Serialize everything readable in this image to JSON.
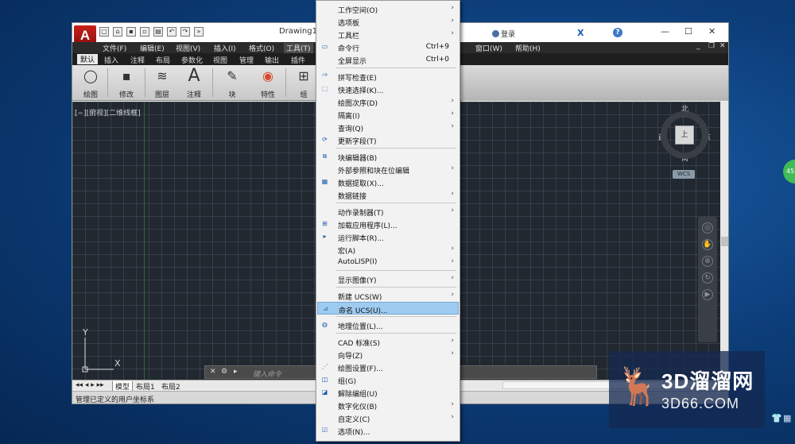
{
  "app": {
    "logo_glyph": "A",
    "document_title": "Drawing1.d",
    "login_label": "登录",
    "help_glyph": "?",
    "x_glyph": "X"
  },
  "menu_bar": {
    "items": [
      "文件(F)",
      "编辑(E)",
      "视图(V)",
      "插入(I)",
      "格式(O)",
      "工具(T)",
      "窗口(W)",
      "帮助(H)"
    ],
    "active": "工具(T)"
  },
  "ribbon_tabs": [
    "默认",
    "插入",
    "注释",
    "布局",
    "参数化",
    "视图",
    "管理",
    "输出",
    "插件"
  ],
  "ribbon_panels": [
    "绘图",
    "修改",
    "图层",
    "注释",
    "块",
    "特性",
    "组"
  ],
  "viewport": {
    "label": "[−][俯视][二维线框]",
    "compass": {
      "north": "北",
      "south": "南",
      "east": "东",
      "west": "西",
      "center": "上"
    },
    "wcs": "WCS",
    "ucs_x": "X",
    "ucs_y": "Y"
  },
  "command_line": {
    "placeholder": "键入命令"
  },
  "layout_tabs": [
    "模型",
    "布局1",
    "布局2"
  ],
  "status_bar": {
    "text": "管理已定义的用户坐标系"
  },
  "tools_menu": {
    "items": [
      {
        "label": "工作空间(O)",
        "submenu": true
      },
      {
        "label": "选项板",
        "submenu": true
      },
      {
        "label": "工具栏",
        "submenu": true
      },
      {
        "label": "命令行",
        "shortcut": "Ctrl+9",
        "icon": "command-line-icon"
      },
      {
        "label": "全屏显示",
        "shortcut": "Ctrl+0"
      },
      {
        "label": "拼写检查(E)",
        "icon": "spellcheck-icon"
      },
      {
        "label": "快速选择(K)...",
        "icon": "quick-select-icon"
      },
      {
        "label": "绘图次序(D)",
        "submenu": true
      },
      {
        "label": "隔离(I)",
        "submenu": true
      },
      {
        "label": "查询(Q)",
        "submenu": true
      },
      {
        "label": "更新字段(T)",
        "icon": "update-field-icon"
      },
      {
        "label": "块编辑器(B)",
        "icon": "block-editor-icon"
      },
      {
        "label": "外部参照和块在位编辑",
        "submenu": true
      },
      {
        "label": "数据提取(X)...",
        "icon": "data-extract-icon"
      },
      {
        "label": "数据链接",
        "submenu": true
      },
      {
        "label": "动作录制器(T)",
        "submenu": true
      },
      {
        "label": "加载应用程序(L)...",
        "icon": "load-app-icon"
      },
      {
        "label": "运行脚本(R)...",
        "icon": "run-script-icon"
      },
      {
        "label": "宏(A)",
        "submenu": true
      },
      {
        "label": "AutoLISP(I)",
        "submenu": true
      },
      {
        "label": "显示图像(Y)",
        "submenu": true
      },
      {
        "label": "新建 UCS(W)",
        "submenu": true
      },
      {
        "label": "命名 UCS(U)...",
        "icon": "named-ucs-icon",
        "highlight": true
      },
      {
        "label": "地理位置(L)...",
        "icon": "geo-location-icon"
      },
      {
        "label": "CAD 标准(S)",
        "submenu": true
      },
      {
        "label": "向导(Z)",
        "submenu": true
      },
      {
        "label": "绘图设置(F)...",
        "icon": "drafting-settings-icon"
      },
      {
        "label": "组(G)",
        "icon": "group-icon"
      },
      {
        "label": "解除编组(U)",
        "icon": "ungroup-icon"
      },
      {
        "label": "数字化仪(B)",
        "submenu": true
      },
      {
        "label": "自定义(C)",
        "submenu": true
      },
      {
        "label": "选项(N)...",
        "icon": "options-icon"
      }
    ]
  },
  "watermark": {
    "title": "3D溜溜网",
    "subtitle": "3D66.COM"
  },
  "side_badge": "45"
}
